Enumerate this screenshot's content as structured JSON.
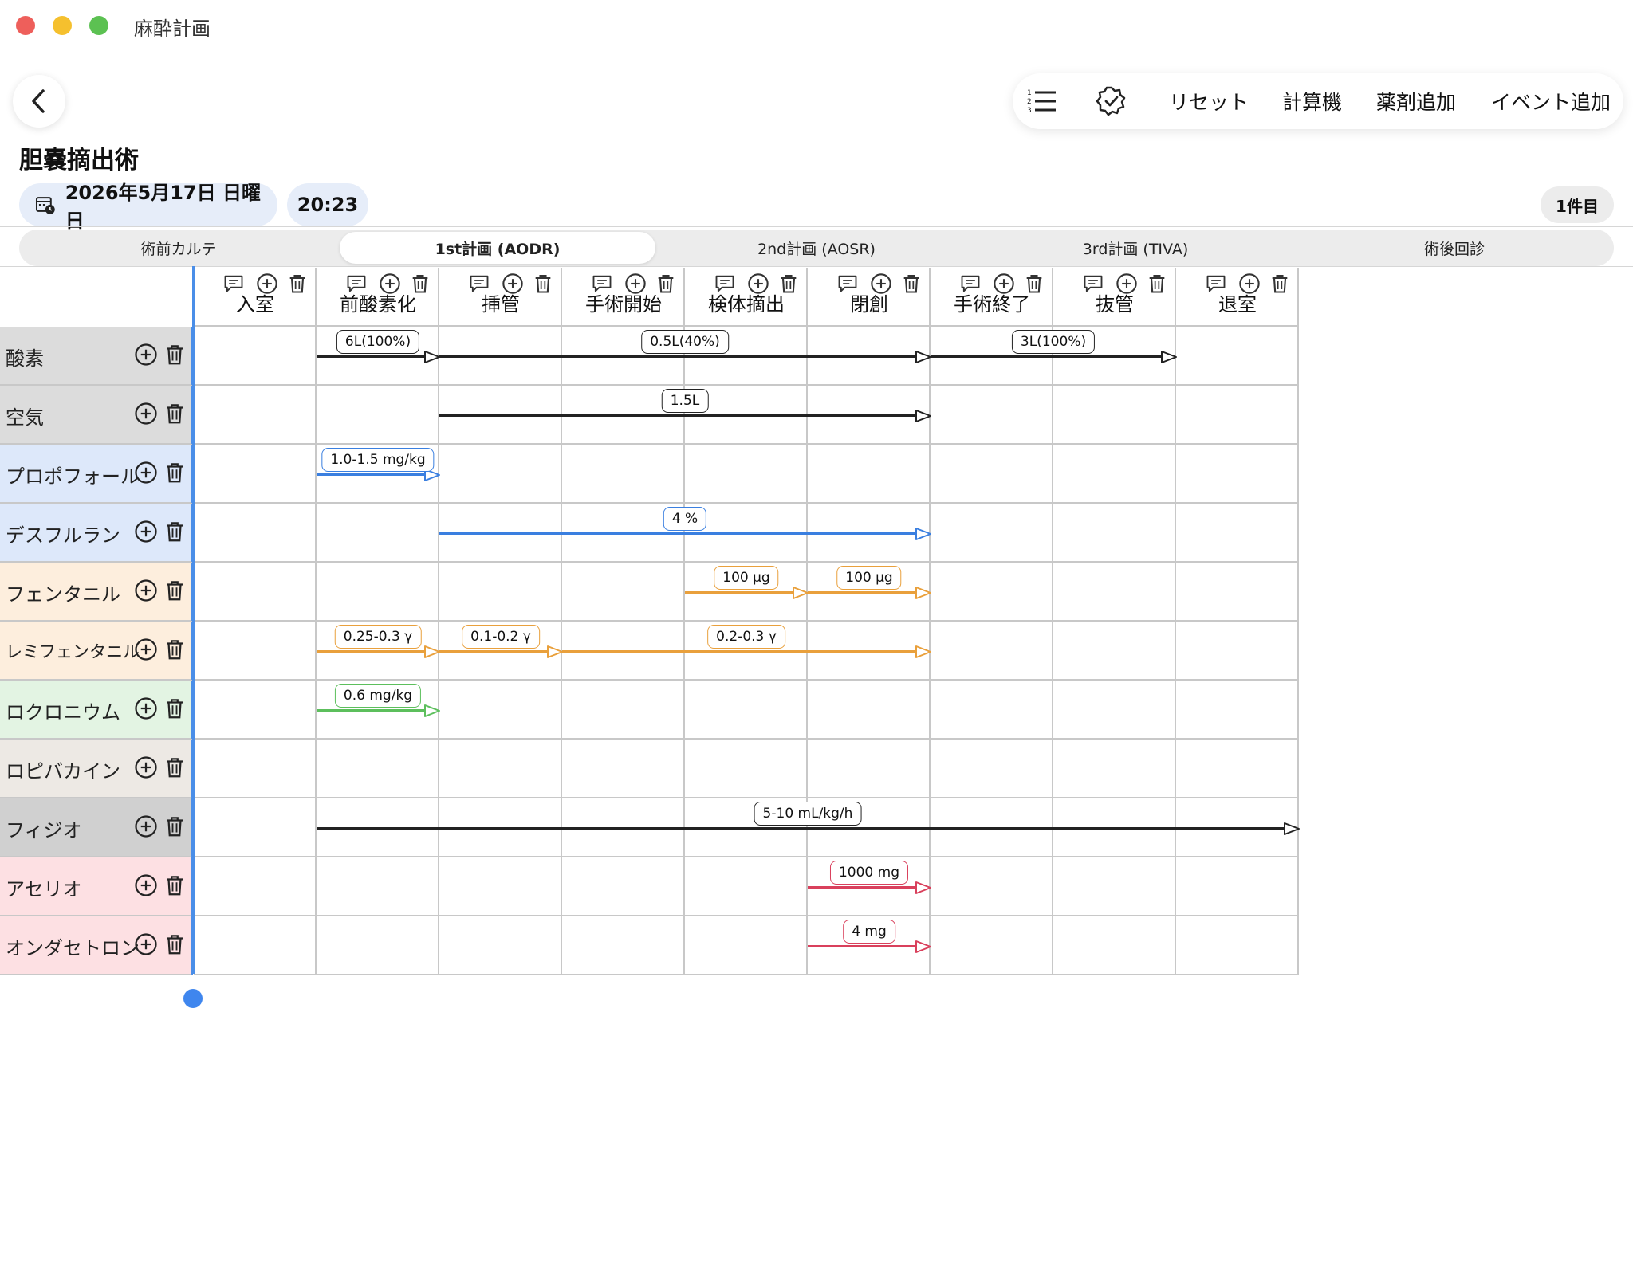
{
  "window": {
    "title": "麻酔計画"
  },
  "toolbar": {
    "reset_label": "リセット",
    "calculator_label": "計算機",
    "add_drug_label": "薬剤追加",
    "add_event_label": "イベント追加"
  },
  "surgery_name": "胆嚢摘出術",
  "date_text": "2026年5月17日 日曜日",
  "time_text": "20:23",
  "count_text": "1件目",
  "tabs": [
    {
      "label": "術前カルテ"
    },
    {
      "label": "1st計画 (AODR)"
    },
    {
      "label": "2nd計画 (AOSR)"
    },
    {
      "label": "3rd計画 (TIVA)"
    },
    {
      "label": "術後回診"
    }
  ],
  "active_tab": 1,
  "events": [
    "入室",
    "前酸素化",
    "挿管",
    "手術開始",
    "検体摘出",
    "閉創",
    "手術終了",
    "抜管",
    "退室"
  ],
  "drugs": [
    {
      "name": "酸素",
      "bg": "#dcdcdc"
    },
    {
      "name": "空気",
      "bg": "#dcdcdc"
    },
    {
      "name": "プロポフォール",
      "bg": "#dde8fa"
    },
    {
      "name": "デスフルラン",
      "bg": "#dde8fa"
    },
    {
      "name": "フェンタニル",
      "bg": "#fdeedd"
    },
    {
      "name": "レミフェンタニル",
      "bg": "#fdeedd"
    },
    {
      "name": "ロクロニウム",
      "bg": "#e3f4e3"
    },
    {
      "name": "ロピバカイン",
      "bg": "#ede9e4"
    },
    {
      "name": "フィジオ",
      "bg": "#d0d0d0"
    },
    {
      "name": "アセリオ",
      "bg": "#fde0e3"
    },
    {
      "name": "オンダセトロン",
      "bg": "#fde0e3"
    }
  ],
  "colors": {
    "black": "#222222",
    "blue": "#3a7fe0",
    "orange": "#e9a03c",
    "green": "#5cbf5c",
    "red": "#d9405c",
    "accent": "#4a8ee8"
  },
  "plan_bars": [
    {
      "row": 0,
      "from": 1,
      "to": 2,
      "label": "6L(100%)",
      "color": "black"
    },
    {
      "row": 0,
      "from": 2,
      "to": 6,
      "label": "0.5L(40%)",
      "color": "black"
    },
    {
      "row": 0,
      "from": 6,
      "to": 8,
      "label": "3L(100%)",
      "color": "black"
    },
    {
      "row": 1,
      "from": 2,
      "to": 6,
      "label": "1.5L",
      "color": "black"
    },
    {
      "row": 2,
      "from": 1,
      "to": 2,
      "label": "1.0-1.5 mg/kg",
      "color": "blue"
    },
    {
      "row": 3,
      "from": 2,
      "to": 6,
      "label": "4 %",
      "color": "blue"
    },
    {
      "row": 4,
      "from": 4,
      "to": 5,
      "label": "100 µg",
      "color": "orange"
    },
    {
      "row": 4,
      "from": 5,
      "to": 6,
      "label": "100 µg",
      "color": "orange"
    },
    {
      "row": 5,
      "from": 1,
      "to": 2,
      "label": "0.25-0.3 γ",
      "color": "orange"
    },
    {
      "row": 5,
      "from": 2,
      "to": 3,
      "label": "0.1-0.2 γ",
      "color": "orange"
    },
    {
      "row": 5,
      "from": 3,
      "to": 6,
      "label": "0.2-0.3 γ",
      "color": "orange",
      "label_col": 4
    },
    {
      "row": 6,
      "from": 1,
      "to": 2,
      "label": "0.6 mg/kg",
      "color": "green"
    },
    {
      "row": 8,
      "from": 1,
      "to": 9,
      "label": "5-10 mL/kg/h",
      "color": "black"
    },
    {
      "row": 9,
      "from": 5,
      "to": 6,
      "label": "1000 mg",
      "color": "red"
    },
    {
      "row": 10,
      "from": 5,
      "to": 6,
      "label": "4 mg",
      "color": "red"
    }
  ]
}
